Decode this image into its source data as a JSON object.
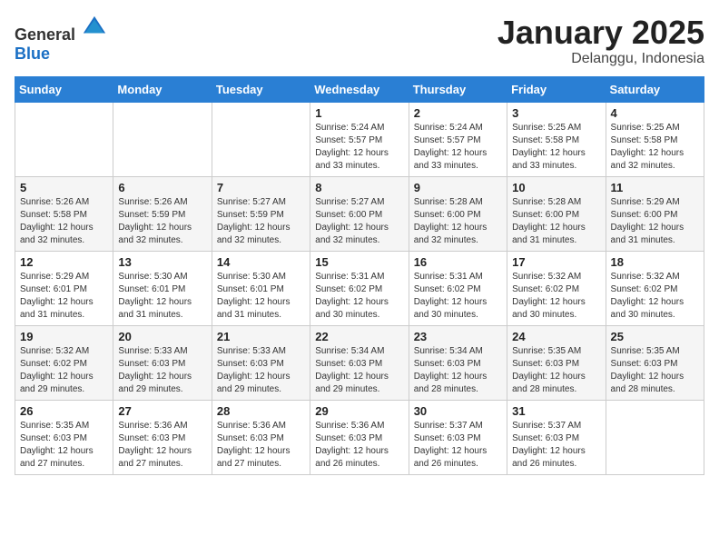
{
  "header": {
    "logo_general": "General",
    "logo_blue": "Blue",
    "month": "January 2025",
    "location": "Delanggu, Indonesia"
  },
  "weekdays": [
    "Sunday",
    "Monday",
    "Tuesday",
    "Wednesday",
    "Thursday",
    "Friday",
    "Saturday"
  ],
  "weeks": [
    [
      {
        "day": "",
        "sunrise": "",
        "sunset": "",
        "daylight": ""
      },
      {
        "day": "",
        "sunrise": "",
        "sunset": "",
        "daylight": ""
      },
      {
        "day": "",
        "sunrise": "",
        "sunset": "",
        "daylight": ""
      },
      {
        "day": "1",
        "sunrise": "Sunrise: 5:24 AM",
        "sunset": "Sunset: 5:57 PM",
        "daylight": "Daylight: 12 hours and 33 minutes."
      },
      {
        "day": "2",
        "sunrise": "Sunrise: 5:24 AM",
        "sunset": "Sunset: 5:57 PM",
        "daylight": "Daylight: 12 hours and 33 minutes."
      },
      {
        "day": "3",
        "sunrise": "Sunrise: 5:25 AM",
        "sunset": "Sunset: 5:58 PM",
        "daylight": "Daylight: 12 hours and 33 minutes."
      },
      {
        "day": "4",
        "sunrise": "Sunrise: 5:25 AM",
        "sunset": "Sunset: 5:58 PM",
        "daylight": "Daylight: 12 hours and 32 minutes."
      }
    ],
    [
      {
        "day": "5",
        "sunrise": "Sunrise: 5:26 AM",
        "sunset": "Sunset: 5:58 PM",
        "daylight": "Daylight: 12 hours and 32 minutes."
      },
      {
        "day": "6",
        "sunrise": "Sunrise: 5:26 AM",
        "sunset": "Sunset: 5:59 PM",
        "daylight": "Daylight: 12 hours and 32 minutes."
      },
      {
        "day": "7",
        "sunrise": "Sunrise: 5:27 AM",
        "sunset": "Sunset: 5:59 PM",
        "daylight": "Daylight: 12 hours and 32 minutes."
      },
      {
        "day": "8",
        "sunrise": "Sunrise: 5:27 AM",
        "sunset": "Sunset: 6:00 PM",
        "daylight": "Daylight: 12 hours and 32 minutes."
      },
      {
        "day": "9",
        "sunrise": "Sunrise: 5:28 AM",
        "sunset": "Sunset: 6:00 PM",
        "daylight": "Daylight: 12 hours and 32 minutes."
      },
      {
        "day": "10",
        "sunrise": "Sunrise: 5:28 AM",
        "sunset": "Sunset: 6:00 PM",
        "daylight": "Daylight: 12 hours and 31 minutes."
      },
      {
        "day": "11",
        "sunrise": "Sunrise: 5:29 AM",
        "sunset": "Sunset: 6:00 PM",
        "daylight": "Daylight: 12 hours and 31 minutes."
      }
    ],
    [
      {
        "day": "12",
        "sunrise": "Sunrise: 5:29 AM",
        "sunset": "Sunset: 6:01 PM",
        "daylight": "Daylight: 12 hours and 31 minutes."
      },
      {
        "day": "13",
        "sunrise": "Sunrise: 5:30 AM",
        "sunset": "Sunset: 6:01 PM",
        "daylight": "Daylight: 12 hours and 31 minutes."
      },
      {
        "day": "14",
        "sunrise": "Sunrise: 5:30 AM",
        "sunset": "Sunset: 6:01 PM",
        "daylight": "Daylight: 12 hours and 31 minutes."
      },
      {
        "day": "15",
        "sunrise": "Sunrise: 5:31 AM",
        "sunset": "Sunset: 6:02 PM",
        "daylight": "Daylight: 12 hours and 30 minutes."
      },
      {
        "day": "16",
        "sunrise": "Sunrise: 5:31 AM",
        "sunset": "Sunset: 6:02 PM",
        "daylight": "Daylight: 12 hours and 30 minutes."
      },
      {
        "day": "17",
        "sunrise": "Sunrise: 5:32 AM",
        "sunset": "Sunset: 6:02 PM",
        "daylight": "Daylight: 12 hours and 30 minutes."
      },
      {
        "day": "18",
        "sunrise": "Sunrise: 5:32 AM",
        "sunset": "Sunset: 6:02 PM",
        "daylight": "Daylight: 12 hours and 30 minutes."
      }
    ],
    [
      {
        "day": "19",
        "sunrise": "Sunrise: 5:32 AM",
        "sunset": "Sunset: 6:02 PM",
        "daylight": "Daylight: 12 hours and 29 minutes."
      },
      {
        "day": "20",
        "sunrise": "Sunrise: 5:33 AM",
        "sunset": "Sunset: 6:03 PM",
        "daylight": "Daylight: 12 hours and 29 minutes."
      },
      {
        "day": "21",
        "sunrise": "Sunrise: 5:33 AM",
        "sunset": "Sunset: 6:03 PM",
        "daylight": "Daylight: 12 hours and 29 minutes."
      },
      {
        "day": "22",
        "sunrise": "Sunrise: 5:34 AM",
        "sunset": "Sunset: 6:03 PM",
        "daylight": "Daylight: 12 hours and 29 minutes."
      },
      {
        "day": "23",
        "sunrise": "Sunrise: 5:34 AM",
        "sunset": "Sunset: 6:03 PM",
        "daylight": "Daylight: 12 hours and 28 minutes."
      },
      {
        "day": "24",
        "sunrise": "Sunrise: 5:35 AM",
        "sunset": "Sunset: 6:03 PM",
        "daylight": "Daylight: 12 hours and 28 minutes."
      },
      {
        "day": "25",
        "sunrise": "Sunrise: 5:35 AM",
        "sunset": "Sunset: 6:03 PM",
        "daylight": "Daylight: 12 hours and 28 minutes."
      }
    ],
    [
      {
        "day": "26",
        "sunrise": "Sunrise: 5:35 AM",
        "sunset": "Sunset: 6:03 PM",
        "daylight": "Daylight: 12 hours and 27 minutes."
      },
      {
        "day": "27",
        "sunrise": "Sunrise: 5:36 AM",
        "sunset": "Sunset: 6:03 PM",
        "daylight": "Daylight: 12 hours and 27 minutes."
      },
      {
        "day": "28",
        "sunrise": "Sunrise: 5:36 AM",
        "sunset": "Sunset: 6:03 PM",
        "daylight": "Daylight: 12 hours and 27 minutes."
      },
      {
        "day": "29",
        "sunrise": "Sunrise: 5:36 AM",
        "sunset": "Sunset: 6:03 PM",
        "daylight": "Daylight: 12 hours and 26 minutes."
      },
      {
        "day": "30",
        "sunrise": "Sunrise: 5:37 AM",
        "sunset": "Sunset: 6:03 PM",
        "daylight": "Daylight: 12 hours and 26 minutes."
      },
      {
        "day": "31",
        "sunrise": "Sunrise: 5:37 AM",
        "sunset": "Sunset: 6:03 PM",
        "daylight": "Daylight: 12 hours and 26 minutes."
      },
      {
        "day": "",
        "sunrise": "",
        "sunset": "",
        "daylight": ""
      }
    ]
  ]
}
